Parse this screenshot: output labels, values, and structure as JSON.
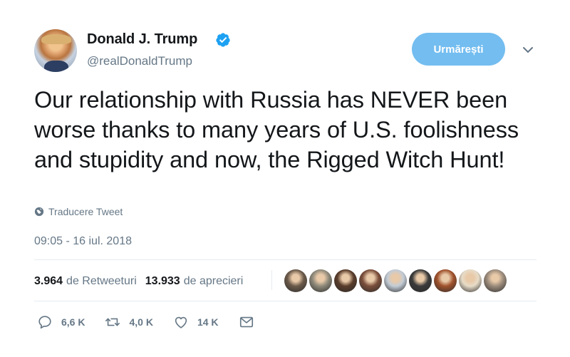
{
  "user": {
    "display_name": "Donald J. Trump",
    "screen_name": "@realDonaldTrump",
    "verified": true
  },
  "follow_button": {
    "label": "Urmărești"
  },
  "tweet": {
    "text": "Our relationship with Russia has NEVER been worse thanks to many years of U.S. foolishness and stupidity and now, the Rigged Witch Hunt!",
    "translate_label": "Traducere Tweet",
    "timestamp": "09:05 - 16 iul. 2018"
  },
  "stats": {
    "retweets_count": "3.964",
    "retweets_label": "de Retweeturi",
    "likes_count": "13.933",
    "likes_label": "de aprecieri"
  },
  "likers": [
    {
      "name": "liker-avatar-1",
      "color": "#6b5a4a"
    },
    {
      "name": "liker-avatar-2",
      "color": "#8f8a7a"
    },
    {
      "name": "liker-avatar-3",
      "color": "#5a3d2b"
    },
    {
      "name": "liker-avatar-4",
      "color": "#7a4e3a"
    },
    {
      "name": "liker-avatar-5",
      "color": "#c3ccd6"
    },
    {
      "name": "liker-avatar-6",
      "color": "#3a3a3a"
    },
    {
      "name": "liker-avatar-7",
      "color": "#a0522d"
    },
    {
      "name": "liker-avatar-8",
      "color": "#e8dcc8"
    },
    {
      "name": "liker-avatar-9",
      "color": "#9c8c7c"
    }
  ],
  "actions": {
    "reply_count": "6,6 K",
    "retweet_count": "4,0 K",
    "like_count": "14 K"
  },
  "colors": {
    "accent": "#73bdf0",
    "verified": "#1da1f2",
    "secondary_text": "#657786",
    "divider": "#e6ecf0"
  }
}
